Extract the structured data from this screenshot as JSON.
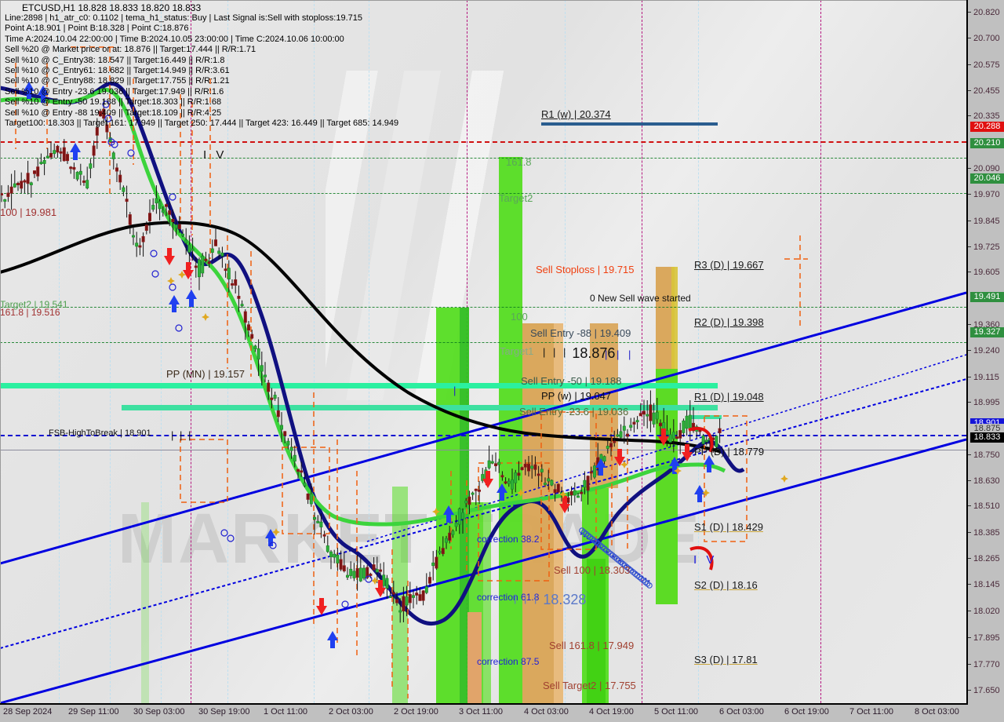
{
  "header": {
    "symbol_line": "ETCUSD,H1  18.828 18.833 18.820 18.833",
    "lines": [
      "Line:2898 | h1_atr_c0: 0.1102 | tema_h1_status: Buy | Last Signal is:Sell with stoploss:19.715",
      "Point A:18.901 | Point B:18.328 | Point C:18.876",
      "Time A:2024.10.04 22:00:00 | Time B:2024.10.05 23:00:00 | Time C:2024.10.06 10:00:00",
      "Sell %20 @ Market price or at: 18.876 || Target:17.444 || R/R:1.71",
      "Sell %10 @ C_Entry38: 18.547 || Target:16.449 || R/R:1.8",
      "Sell %10 @ C_Entry61: 18.682 || Target:14.949 || R/R:3.61",
      "Sell %10 @ C_Entry88: 18.829 || Target:17.755 || R/R:1.21",
      "Sell %10 @ Entry -23.6 19.036 || Target:17.949 || R/R:1.6",
      "Sell %10 @ Entry -50 19.188 || Target:18.303 || R/R:1.68",
      "Sell %10 @ Entry -88 19.409 || Target:18.109 || R/R:4.25",
      "Target100: 18.303 || Target 161: 17.949 || Target 250: 17.444 || Target 423: 16.449 || Target 685: 14.949"
    ]
  },
  "watermark": {
    "text": "MARKET TRADE"
  },
  "chart_data": {
    "type": "line",
    "title": "ETCUSD,H1",
    "symbol": "ETCUSD",
    "timeframe": "H1",
    "ohlc": {
      "open": 18.828,
      "high": 18.833,
      "low": 18.82,
      "close": 18.833
    },
    "ylim": [
      17.59,
      20.88
    ],
    "xlabel": "",
    "ylabel": "",
    "grid": true,
    "legend": "none",
    "y_ticks": [
      "20.820",
      "20.700",
      "20.575",
      "20.455",
      "20.335",
      "20.090",
      "19.970",
      "19.845",
      "19.725",
      "19.605",
      "19.360",
      "19.240",
      "19.115",
      "18.995",
      "18.750",
      "18.630",
      "18.510",
      "18.385",
      "18.265",
      "18.145",
      "18.020",
      "17.895",
      "17.770",
      "17.650"
    ],
    "y_highlights": [
      {
        "value": "20.288",
        "color": "#e01010",
        "text": "#ffffff"
      },
      {
        "value": "20.210",
        "color": "#2f8f3f",
        "text": "#ffffff"
      },
      {
        "value": "20.046",
        "color": "#2f8f3f",
        "text": "#ffffff"
      },
      {
        "value": "19.491",
        "color": "#2f8f3f",
        "text": "#ffffff"
      },
      {
        "value": "19.327",
        "color": "#2f8f3f",
        "text": "#ffffff"
      },
      {
        "value": "18.901",
        "color": "#1414d8",
        "text": "#ffffff"
      },
      {
        "value": "18.875",
        "color": "#c0c0c0",
        "text": "#333333"
      },
      {
        "value": "18.833",
        "color": "#000000",
        "text": "#ffffff"
      }
    ],
    "x_ticks": [
      "28 Sep 2024",
      "29 Sep 11:00",
      "30 Sep 03:00",
      "30 Sep 19:00",
      "1 Oct 11:00",
      "2 Oct 03:00",
      "2 Oct 19:00",
      "3 Oct 11:00",
      "4 Oct 03:00",
      "4 Oct 19:00",
      "5 Oct 11:00",
      "6 Oct 03:00",
      "6 Oct 19:00",
      "7 Oct 11:00",
      "8 Oct 03:00"
    ]
  },
  "pivot_levels": [
    {
      "name": "R1 (w) | 20.374",
      "value": 20.374
    },
    {
      "name": "R3 (D) | 19.667",
      "value": 19.667
    },
    {
      "name": "R2 (D) | 19.398",
      "value": 19.398
    },
    {
      "name": "R1 (D) | 19.048",
      "value": 19.048
    },
    {
      "name": "PP (w) | 19.047",
      "value": 19.047
    },
    {
      "name": "PP (D) | 18.779",
      "value": 18.779
    },
    {
      "name": "PP (MN) | 19.157",
      "value": 19.157
    },
    {
      "name": "S1 (D) | 18.429",
      "value": 18.429
    },
    {
      "name": "S2 (D) | 18.16",
      "value": 18.16
    },
    {
      "name": "S3 (D) | 17.81",
      "value": 17.81
    }
  ],
  "annotations": {
    "sell_stoploss": "Sell Stoploss | 19.715",
    "new_wave": "0 New Sell wave started",
    "sell_entry_88": "Sell Entry -88 | 19.409",
    "sell_entry_50": "Sell Entry -50 | 19.188",
    "sell_entry_236": "Sell Entry -23.6 | 19.036",
    "sell_100": "Sell 100 | 18.303",
    "sell_1618": "Sell 161.8 | 17.949",
    "sell_target2": "Sell Target2 | 17.755",
    "fsb_high": "FSB-HighToBreak | 18.901",
    "left_100": "100 | 19.981",
    "left_target2": "Target2 | 19.541",
    "left_1618": "161.8 | 19.516",
    "fib_1618": "161.8",
    "fib_target2": "Target2",
    "fib_100": "100",
    "fib_target1": "Target1",
    "correction_382": "correction 38.2",
    "correction_618": "correction 61.8",
    "correction_875": "correction 87.5",
    "price_18876": "18.876",
    "price_18328": "18.328",
    "wave_black": "I V",
    "wave_blue": "I V"
  },
  "colors": {
    "bull_candle": "#1d8f2a",
    "bear_candle": "#8f1d1d",
    "ma_black": "#000000",
    "ma_navy": "#101080",
    "ma_green": "#3cd43c",
    "channel_blue": "#0000e0",
    "zone_green": "#55dd22",
    "zone_orange": "#e0a050",
    "arrow_up": "#2040f0",
    "arrow_down": "#f02020",
    "fib_line": "#0a7a1e",
    "bg": "#e8e8e8",
    "scale_bg": "#c0c0c0"
  }
}
